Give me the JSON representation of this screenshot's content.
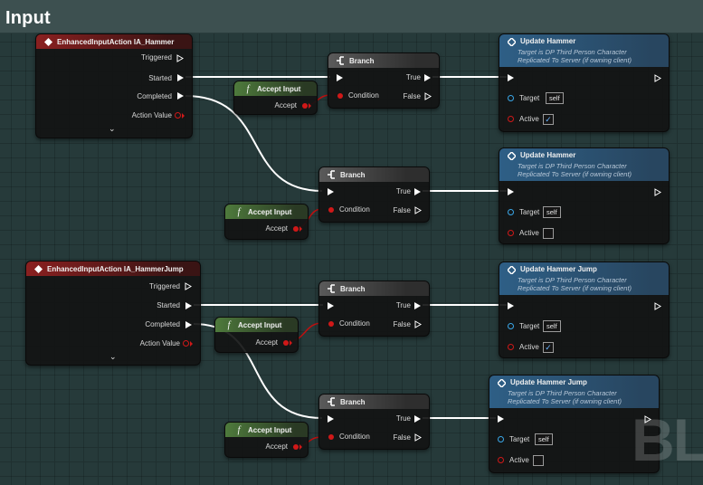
{
  "comment": {
    "title": "Input"
  },
  "watermark": "BL",
  "input_nodes": [
    {
      "title": "EnhancedInputAction IA_Hammer",
      "pins": [
        "Triggered",
        "Started",
        "Completed",
        "Action Value"
      ]
    },
    {
      "title": "EnhancedInputAction IA_HammerJump",
      "pins": [
        "Triggered",
        "Started",
        "Completed",
        "Action Value"
      ]
    }
  ],
  "branch_nodes": [
    {
      "title": "Branch",
      "condition": "Condition",
      "true": "True",
      "false": "False"
    },
    {
      "title": "Branch",
      "condition": "Condition",
      "true": "True",
      "false": "False"
    },
    {
      "title": "Branch",
      "condition": "Condition",
      "true": "True",
      "false": "False"
    },
    {
      "title": "Branch",
      "condition": "Condition",
      "true": "True",
      "false": "False"
    }
  ],
  "accept_nodes": [
    {
      "title": "Accept Input",
      "pin": "Accept"
    },
    {
      "title": "Accept Input",
      "pin": "Accept"
    },
    {
      "title": "Accept Input",
      "pin": "Accept"
    },
    {
      "title": "Accept Input",
      "pin": "Accept"
    }
  ],
  "update_nodes": [
    {
      "title": "Update Hammer",
      "subtitle1": "Target is DP Third Person Character",
      "subtitle2": "Replicated To Server (if owning client)",
      "target_label": "Target",
      "target_value": "self",
      "active_label": "Active",
      "active_checked": true
    },
    {
      "title": "Update Hammer",
      "subtitle1": "Target is DP Third Person Character",
      "subtitle2": "Replicated To Server (if owning client)",
      "target_label": "Target",
      "target_value": "self",
      "active_label": "Active",
      "active_checked": false
    },
    {
      "title": "Update Hammer Jump",
      "subtitle1": "Target is DP Third Person Character",
      "subtitle2": "Replicated To Server (if owning client)",
      "target_label": "Target",
      "target_value": "self",
      "active_label": "Active",
      "active_checked": true
    },
    {
      "title": "Update Hammer Jump",
      "subtitle1": "Target is DP Third Person Character",
      "subtitle2": "Replicated To Server (if owning client)",
      "target_label": "Target",
      "target_value": "self",
      "active_label": "Active",
      "active_checked": false
    }
  ],
  "check_glyph": "✓",
  "chevron_glyph": "⌄",
  "colors": {
    "exec": "#ffffff",
    "bool": "#d01818",
    "object": "#3aa7e8",
    "input_header": "#8a2020",
    "function_header": "#2e5f86",
    "pure_header": "#4e7a3c"
  }
}
